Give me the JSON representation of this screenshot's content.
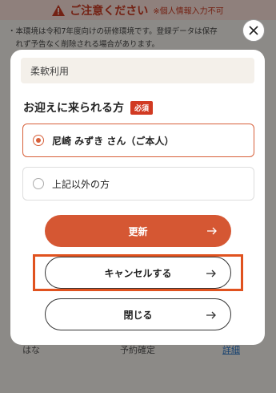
{
  "warning": {
    "title": "ご注意ください",
    "subtitle": "※個人情報入力不可",
    "notice": "・本環境は令和7年度向けの研修環境です。登録データは保存\n　れず予告なく削除される場合があります。"
  },
  "background_row": {
    "name": "はな",
    "status": "予約確定",
    "link": "詳細"
  },
  "modal": {
    "reason_value": "柔軟利用",
    "pickup_label": "お迎えに来られる方",
    "required_badge": "必須",
    "options": [
      {
        "label": "尼崎 みずき さん（ご本人）",
        "selected": true
      },
      {
        "label": "上記以外の方",
        "selected": false
      }
    ],
    "update_button": "更新",
    "cancel_button": "キャンセルする",
    "close_button": "閉じる"
  },
  "colors": {
    "accent": "#d55733",
    "warning_bg": "#f6ddd6",
    "warning_text": "#c63a22",
    "highlight": "#e0521f"
  },
  "icons": {
    "warning": "warning-triangle-icon",
    "close": "close-icon",
    "arrow": "arrow-right-icon"
  }
}
